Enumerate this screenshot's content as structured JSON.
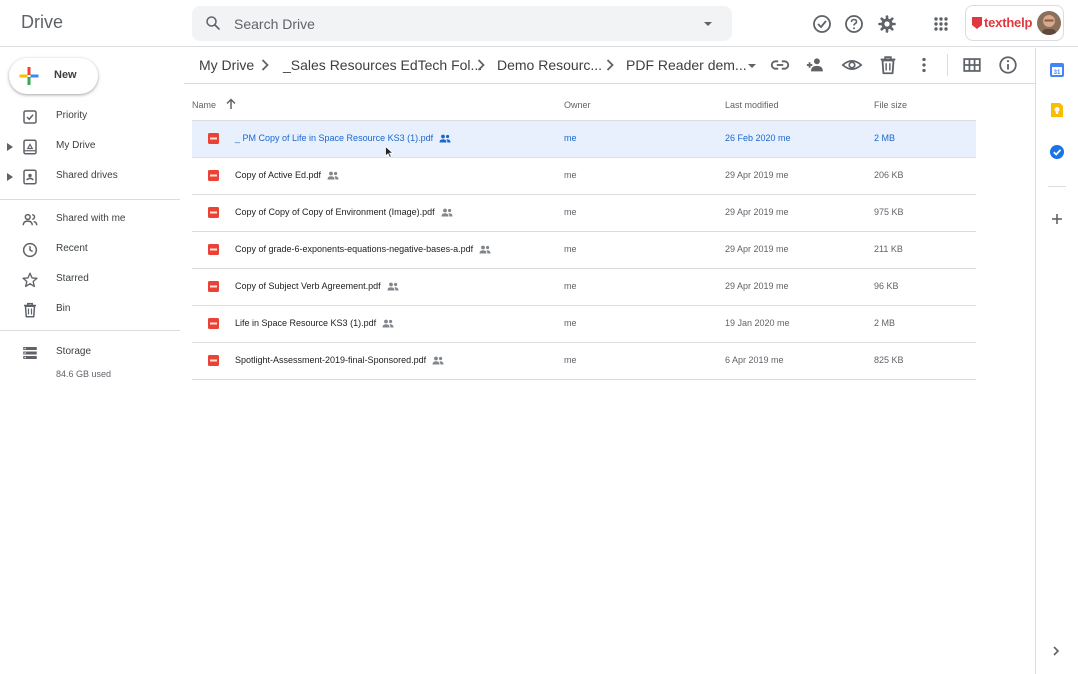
{
  "app": {
    "title": "Drive"
  },
  "search": {
    "placeholder": "Search Drive"
  },
  "account": {
    "brand": "texthelp"
  },
  "new_button": {
    "label": "New"
  },
  "nav": {
    "items": [
      {
        "label": "Priority"
      },
      {
        "label": "My Drive"
      },
      {
        "label": "Shared drives"
      },
      {
        "label": "Shared with me"
      },
      {
        "label": "Recent"
      },
      {
        "label": "Starred"
      },
      {
        "label": "Bin"
      },
      {
        "label": "Storage"
      }
    ],
    "storage_used": "84.6 GB used"
  },
  "breadcrumb": [
    "My Drive",
    "_Sales Resources EdTech Fol...",
    "Demo Resourc...",
    "PDF Reader dem..."
  ],
  "table": {
    "headers": {
      "name": "Name",
      "owner": "Owner",
      "modified": "Last modified",
      "size": "File size"
    },
    "rows": [
      {
        "name": "_ PM Copy of Life in Space Resource KS3 (1).pdf",
        "owner": "me",
        "modified": "26 Feb 2020  me",
        "size": "2 MB"
      },
      {
        "name": "Copy of Active Ed.pdf",
        "owner": "me",
        "modified": "29 Apr 2019  me",
        "size": "206 KB"
      },
      {
        "name": "Copy of Copy of Copy of Environment (Image).pdf",
        "owner": "me",
        "modified": "29 Apr 2019  me",
        "size": "975 KB"
      },
      {
        "name": "Copy of grade-6-exponents-equations-negative-bases-a.pdf",
        "owner": "me",
        "modified": "29 Apr 2019  me",
        "size": "211 KB"
      },
      {
        "name": "Copy of Subject Verb Agreement.pdf",
        "owner": "me",
        "modified": "29 Apr 2019  me",
        "size": "96 KB"
      },
      {
        "name": "Life in Space Resource KS3 (1).pdf",
        "owner": "me",
        "modified": "19 Jan 2020  me",
        "size": "2 MB"
      },
      {
        "name": "Spotlight-Assessment-2019-final-Sponsored.pdf",
        "owner": "me",
        "modified": "6 Apr 2019  me",
        "size": "825 KB"
      }
    ]
  },
  "colors": {
    "accent": "#1a73e8",
    "selected_row": "#e8f0fe",
    "pdf": "#ea4335",
    "brand": "#e0383e"
  }
}
